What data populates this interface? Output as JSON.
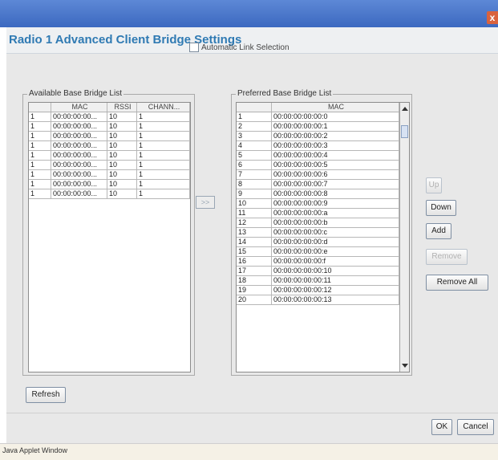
{
  "window": {
    "close_glyph": "x"
  },
  "dialog": {
    "title": "Radio 1 Advanced Client Bridge Settings",
    "auto_link_label": "Automatic Link Selection",
    "available": {
      "title": "Available Base Bridge List",
      "columns": [
        "",
        "MAC",
        "RSSI",
        "CHANN..."
      ],
      "rows": [
        [
          "1",
          "00:00:00:00...",
          "10",
          "1"
        ],
        [
          "1",
          "00:00:00:00...",
          "10",
          "1"
        ],
        [
          "1",
          "00:00:00:00...",
          "10",
          "1"
        ],
        [
          "1",
          "00:00:00:00...",
          "10",
          "1"
        ],
        [
          "1",
          "00:00:00:00...",
          "10",
          "1"
        ],
        [
          "1",
          "00:00:00:00...",
          "10",
          "1"
        ],
        [
          "1",
          "00:00:00:00...",
          "10",
          "1"
        ],
        [
          "1",
          "00:00:00:00...",
          "10",
          "1"
        ],
        [
          "1",
          "00:00:00:00...",
          "10",
          "1"
        ]
      ]
    },
    "move_button": ">>",
    "preferred": {
      "title": "Preferred Base Bridge List",
      "columns": [
        "",
        "MAC"
      ],
      "rows": [
        [
          "1",
          "00:00:00:00:00:0"
        ],
        [
          "2",
          "00:00:00:00:00:1"
        ],
        [
          "3",
          "00:00:00:00:00:2"
        ],
        [
          "4",
          "00:00:00:00:00:3"
        ],
        [
          "5",
          "00:00:00:00:00:4"
        ],
        [
          "6",
          "00:00:00:00:00:5"
        ],
        [
          "7",
          "00:00:00:00:00:6"
        ],
        [
          "8",
          "00:00:00:00:00:7"
        ],
        [
          "9",
          "00:00:00:00:00:8"
        ],
        [
          "10",
          "00:00:00:00:00:9"
        ],
        [
          "11",
          "00:00:00:00:00:a"
        ],
        [
          "12",
          "00:00:00:00:00:b"
        ],
        [
          "13",
          "00:00:00:00:00:c"
        ],
        [
          "14",
          "00:00:00:00:00:d"
        ],
        [
          "15",
          "00:00:00:00:00:e"
        ],
        [
          "16",
          "00:00:00:00:00:f"
        ],
        [
          "17",
          "00:00:00:00:00:10"
        ],
        [
          "18",
          "00:00:00:00:00:11"
        ],
        [
          "19",
          "00:00:00:00:00:12"
        ],
        [
          "20",
          "00:00:00:00:00:13"
        ]
      ]
    },
    "buttons": {
      "up": "Up",
      "down": "Down",
      "add": "Add",
      "remove": "Remove",
      "remove_all": "Remove All",
      "refresh": "Refresh",
      "ok": "OK",
      "cancel": "Cancel"
    }
  },
  "status_bar": {
    "text": "Java Applet Window"
  },
  "colors": {
    "title_bar": "#4a77cc",
    "header_text": "#2f7ab3",
    "close_button": "#d9623e"
  }
}
